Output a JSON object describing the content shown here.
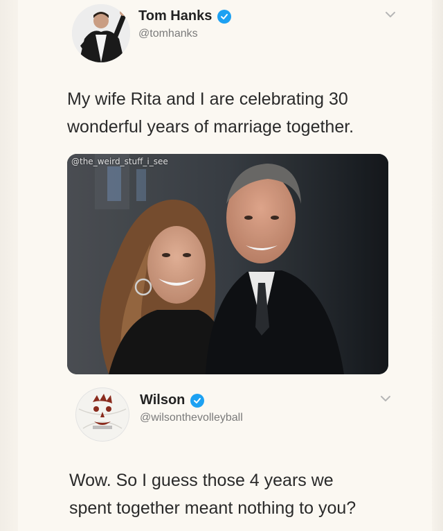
{
  "tweet1": {
    "name": "Tom Hanks",
    "handle": "@tomhanks",
    "text_line1": "My wife Rita and I are celebrating 30",
    "text_line2": "wonderful years of marriage together.",
    "photo_watermark": "@the_weird_stuff_i_see",
    "verified_icon": "verified-badge-icon",
    "menu_icon": "chevron-down-icon"
  },
  "tweet2": {
    "name": "Wilson",
    "handle": "@wilsonthevolleyball",
    "text_line1": "Wow. So I guess those 4 years we",
    "text_line2": "spent together meant nothing to you?",
    "verified_icon": "verified-badge-icon",
    "menu_icon": "chevron-down-icon"
  },
  "colors": {
    "background": "#fbf8f2",
    "verified": "#1da1f2",
    "handle": "#7a7a7a",
    "text": "#2a2a2a"
  }
}
